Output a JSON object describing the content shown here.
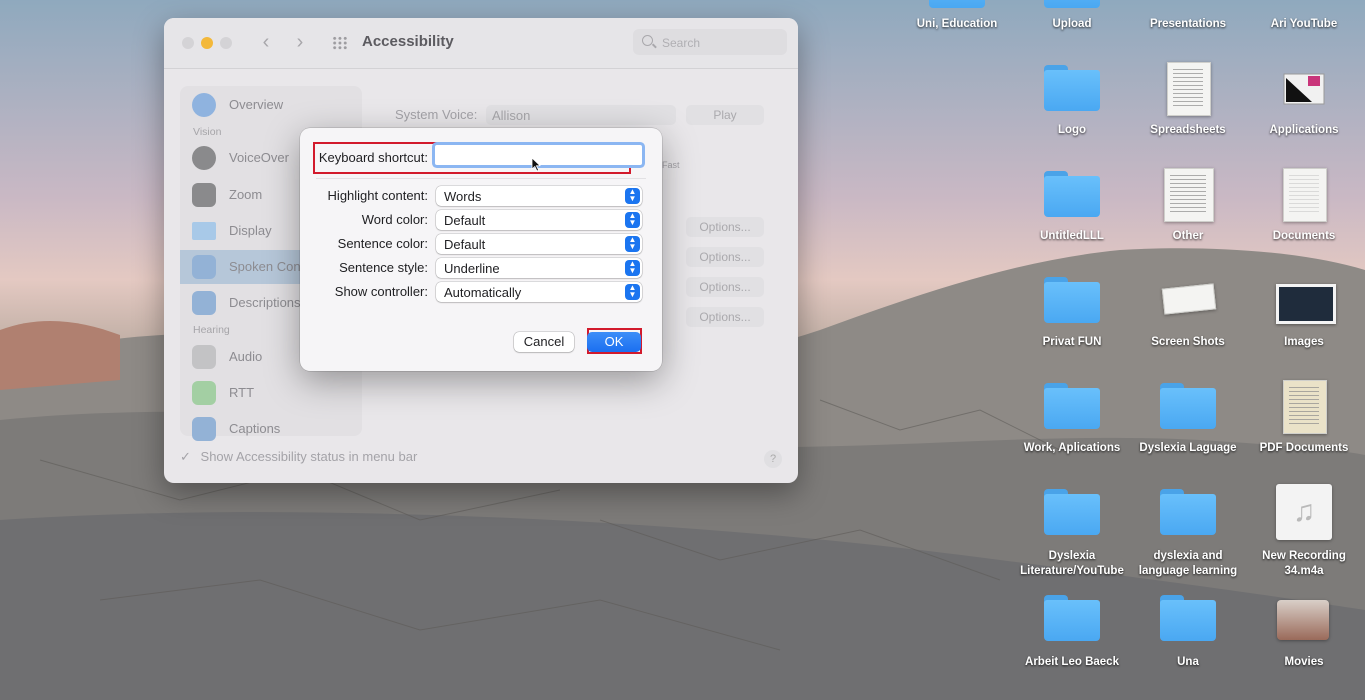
{
  "window": {
    "title": "Accessibility",
    "search_placeholder": "Search",
    "sidebar": {
      "sections": {
        "vision": "Vision",
        "hearing": "Hearing"
      },
      "items": [
        {
          "label": "Overview",
          "icon": "overview-icon",
          "color": "#4a8fe0"
        },
        {
          "label": "VoiceOver",
          "icon": "voiceover-icon",
          "color": "#3a3a3a"
        },
        {
          "label": "Zoom",
          "icon": "zoom-icon",
          "color": "#3a3a3a"
        },
        {
          "label": "Display",
          "icon": "display-icon",
          "color": "#4aa3e8"
        },
        {
          "label": "Spoken Con",
          "icon": "spoken-content-icon",
          "color": "#4a8fe0"
        },
        {
          "label": "Descriptions",
          "icon": "descriptions-icon",
          "color": "#4a8fe0"
        },
        {
          "label": "Audio",
          "icon": "audio-icon",
          "color": "#9a9a9a"
        },
        {
          "label": "RTT",
          "icon": "rtt-icon",
          "color": "#3cae4a"
        },
        {
          "label": "Captions",
          "icon": "captions-icon",
          "color": "#4a8fe0"
        }
      ]
    },
    "content": {
      "system_voice_label": "System Voice:",
      "system_voice_value": "Allison",
      "play_button": "Play",
      "rate_fast": "Fast",
      "options_buttons": [
        "Options...",
        "Options...",
        "Options...",
        "Options..."
      ]
    },
    "status_checkbox_label": "Show Accessibility status in menu bar",
    "help": "?"
  },
  "dialog": {
    "keyboard_shortcut_label": "Keyboard shortcut:",
    "keyboard_shortcut_value": "",
    "rows": [
      {
        "label": "Highlight content:",
        "value": "Words"
      },
      {
        "label": "Word color:",
        "value": "Default"
      },
      {
        "label": "Sentence color:",
        "value": "Default"
      },
      {
        "label": "Sentence style:",
        "value": "Underline"
      },
      {
        "label": "Show controller:",
        "value": "Automatically"
      }
    ],
    "cancel_label": "Cancel",
    "ok_label": "OK",
    "highlight_color": "#d21a2c",
    "accent_color": "#1b75f0"
  },
  "desktop": {
    "icons": [
      {
        "label": "Uni, Education",
        "kind": "folder"
      },
      {
        "label": "Upload",
        "kind": "folder"
      },
      {
        "label": "Presentations",
        "kind": "folder"
      },
      {
        "label": "Ari YouTube",
        "kind": "folder"
      },
      {
        "label": "Logo",
        "kind": "folder"
      },
      {
        "label": "Spreadsheets",
        "kind": "document"
      },
      {
        "label": "Applications",
        "kind": "applications"
      },
      {
        "label": "UntitledLLL",
        "kind": "folder"
      },
      {
        "label": "Other",
        "kind": "document"
      },
      {
        "label": "Documents",
        "kind": "document"
      },
      {
        "label": "Privat FUN",
        "kind": "folder"
      },
      {
        "label": "Screen Shots",
        "kind": "screenshots"
      },
      {
        "label": "Images",
        "kind": "image"
      },
      {
        "label": "Work, Aplications",
        "kind": "folder"
      },
      {
        "label": "Dyslexia Laguage",
        "kind": "folder"
      },
      {
        "label": "PDF Documents",
        "kind": "document"
      },
      {
        "label": "Dyslexia Literature/YouTube",
        "kind": "folder"
      },
      {
        "label": "dyslexia and language learning",
        "kind": "folder"
      },
      {
        "label": "New Recording 34.m4a",
        "kind": "audio"
      },
      {
        "label": "Arbeit Leo Baeck",
        "kind": "folder"
      },
      {
        "label": "Una",
        "kind": "folder"
      },
      {
        "label": "Movies",
        "kind": "movies"
      }
    ]
  }
}
